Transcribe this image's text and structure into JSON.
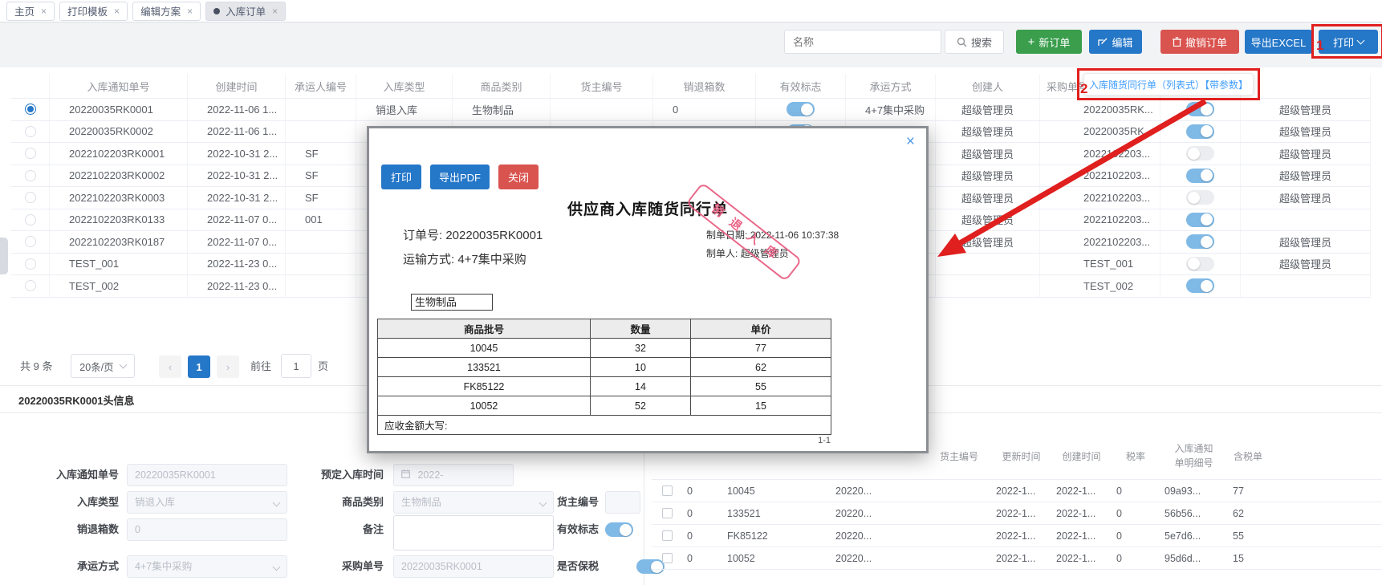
{
  "tabs": {
    "items": [
      {
        "label": "主页",
        "active": false
      },
      {
        "label": "打印模板",
        "active": false
      },
      {
        "label": "编辑方案",
        "active": false
      },
      {
        "label": "入库订单",
        "active": true
      }
    ],
    "close_glyph": "×"
  },
  "toolbar": {
    "search_placeholder": "名称",
    "search_label": "搜索",
    "new_order_label": "新订单",
    "edit_label": "编辑",
    "cancel_order_label": "撤销订单",
    "export_excel_label": "导出EXCEL",
    "print_label": "打印"
  },
  "print_menu": {
    "item_label": "入库随货同行单（列表式）【带参数】"
  },
  "annotations": {
    "step_1": "1",
    "step_2": "2"
  },
  "colors": {
    "accent_blue": "#2577c8",
    "success_green": "#3a9e4d",
    "danger_red": "#d9534f",
    "annotation_red": "#e01f1f",
    "toggle_on_blue": "#7fb9e6",
    "link_blue": "#409eff",
    "stamp_red": "#e85c80"
  },
  "main_table": {
    "headers": [
      "",
      "入库通知单号",
      "创建时间",
      "承运人编号",
      "入库类型",
      "商品类别",
      "货主编号",
      "销退箱数",
      "有效标志",
      "承运方式",
      "创建人",
      "采购单号",
      "",
      ""
    ],
    "rows": [
      {
        "sel": true,
        "notice": "20220035RK0001",
        "created": "2022-11-06 1...",
        "carrier": "",
        "type": "销退入库",
        "cat": "生物制品",
        "owner": "",
        "boxes": "0",
        "valid": true,
        "carry": "4+7集中采购",
        "creator": "超级管理员",
        "po": "20220035RK...",
        "flag": true,
        "admin": "超级管理员"
      },
      {
        "sel": false,
        "notice": "20220035RK0002",
        "created": "2022-11-06 1...",
        "carrier": "",
        "type": "",
        "cat": "",
        "owner": "",
        "boxes": "",
        "valid": true,
        "carry": "",
        "creator": "超级管理员",
        "po": "20220035RK...",
        "flag": true,
        "admin": "超级管理员"
      },
      {
        "sel": false,
        "notice": "2022102203RK0001",
        "created": "2022-10-31 2...",
        "carrier": "SF",
        "type": "",
        "cat": "",
        "owner": "",
        "boxes": "",
        "valid": null,
        "carry": "",
        "creator": "超级管理员",
        "po": "2022102203...",
        "flag": false,
        "admin": "超级管理员"
      },
      {
        "sel": false,
        "notice": "2022102203RK0002",
        "created": "2022-10-31 2...",
        "carrier": "SF",
        "type": "",
        "cat": "",
        "owner": "",
        "boxes": "",
        "valid": null,
        "carry": "",
        "creator": "超级管理员",
        "po": "2022102203...",
        "flag": true,
        "admin": "超级管理员"
      },
      {
        "sel": false,
        "notice": "2022102203RK0003",
        "created": "2022-10-31 2...",
        "carrier": "SF",
        "type": "",
        "cat": "",
        "owner": "",
        "boxes": "",
        "valid": null,
        "carry": "",
        "creator": "超级管理员",
        "po": "2022102203...",
        "flag": false,
        "admin": "超级管理员"
      },
      {
        "sel": false,
        "notice": "2022102203RK0133",
        "created": "2022-11-07 0...",
        "carrier": "001",
        "type": "",
        "cat": "",
        "owner": "",
        "boxes": "",
        "valid": null,
        "carry": "",
        "creator": "超级管理员",
        "po": "2022102203...",
        "flag": true,
        "admin": ""
      },
      {
        "sel": false,
        "notice": "2022102203RK0187",
        "created": "2022-11-07 0...",
        "carrier": "",
        "type": "",
        "cat": "",
        "owner": "",
        "boxes": "",
        "valid": null,
        "carry": "",
        "creator": "超级管理员",
        "po": "2022102203...",
        "flag": true,
        "admin": "超级管理员"
      },
      {
        "sel": false,
        "notice": "TEST_001",
        "created": "2022-11-23 0...",
        "carrier": "",
        "type": "",
        "cat": "",
        "owner": "",
        "boxes": "",
        "valid": null,
        "carry": "",
        "creator": "",
        "po": "TEST_001",
        "flag": false,
        "admin": "超级管理员"
      },
      {
        "sel": false,
        "notice": "TEST_002",
        "created": "2022-11-23 0...",
        "carrier": "",
        "type": "",
        "cat": "",
        "owner": "",
        "boxes": "",
        "valid": null,
        "carry": "",
        "creator": "",
        "po": "TEST_002",
        "flag": true,
        "admin": ""
      }
    ]
  },
  "pagination": {
    "total": "共 9 条",
    "page_size": "20条/页",
    "current": "1",
    "goto_label": "前往",
    "goto_value": "1",
    "unit_label": "页"
  },
  "modal": {
    "close_glyph": "×",
    "buttons": {
      "print": "打印",
      "export_pdf": "导出PDF",
      "close": "关闭"
    },
    "title": "供应商入库随货同行单",
    "order_label": "订单号:",
    "order_value": "20220035RK0001",
    "transport_label": "运输方式:",
    "transport_value": "4+7集中采购",
    "made_date_label": "制单日期:",
    "made_date_value": "2022-11-06 10:37:38",
    "made_by_label": "制单人:",
    "made_by_value": "超级管理员",
    "stamp": "销退入库",
    "category_tag": "生物制品",
    "table": {
      "headers": [
        "商品批号",
        "数量",
        "单价"
      ],
      "rows": [
        [
          "10045",
          "32",
          "77"
        ],
        [
          "133521",
          "10",
          "62"
        ],
        [
          "FK85122",
          "14",
          "55"
        ],
        [
          "10052",
          "52",
          "15"
        ]
      ],
      "footer": "应收金额大写:"
    },
    "page_indicator": "1-1"
  },
  "detail_form": {
    "section_title": "20220035RK0001头信息",
    "notice_no": {
      "label": "入库通知单号",
      "value": "20220035RK0001"
    },
    "planned_time": {
      "label": "预定入库时间",
      "value": "2022-"
    },
    "inbound_type": {
      "label": "入库类型",
      "value": "销退入库"
    },
    "category": {
      "label": "商品类别",
      "value": "生物制品"
    },
    "owner_no": {
      "label": "货主编号",
      "value": ""
    },
    "return_boxes": {
      "label": "销退箱数",
      "value": "0"
    },
    "remark": {
      "label": "备注",
      "value": ""
    },
    "valid_flag": {
      "label": "有效标志",
      "on": true
    },
    "carry_mode": {
      "label": "承运方式",
      "value": "4+7集中采购"
    },
    "po_no": {
      "label": "采购单号",
      "value": "20220035RK0001"
    },
    "bonded": {
      "label": "是否保税",
      "on": true
    }
  },
  "detail_table": {
    "headers": [
      "",
      "",
      "",
      "",
      "",
      "货主编号",
      "更新时间",
      "创建时间",
      "税率",
      "入库通知单明细号",
      "含税单",
      ""
    ],
    "rows": [
      [
        "0",
        "10045",
        "",
        "20220...",
        "",
        "2022-1...",
        "2022-1...",
        "0",
        "09a93...",
        "77"
      ],
      [
        "0",
        "133521",
        "",
        "20220...",
        "",
        "2022-1...",
        "2022-1...",
        "0",
        "56b56...",
        "62"
      ],
      [
        "0",
        "FK85122",
        "",
        "20220...",
        "",
        "2022-1...",
        "2022-1...",
        "0",
        "5e7d6...",
        "55"
      ],
      [
        "0",
        "10052",
        "",
        "20220...",
        "",
        "2022-1...",
        "2022-1...",
        "0",
        "95d6d...",
        "15"
      ]
    ]
  }
}
